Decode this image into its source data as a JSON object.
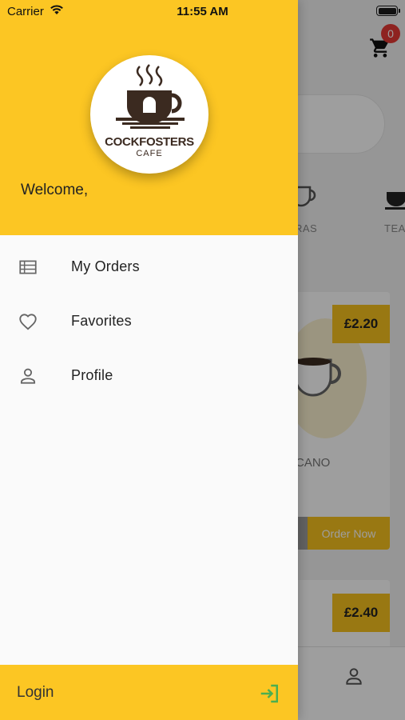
{
  "status_bar": {
    "carrier": "Carrier",
    "time": "11:55 AM"
  },
  "drawer": {
    "logo": {
      "name": "COCKFOSTERS",
      "subtitle": "CAFE"
    },
    "welcome": "Welcome,",
    "menu": [
      {
        "label": "My Orders",
        "icon": "list-icon"
      },
      {
        "label": "Favorites",
        "icon": "heart-icon"
      },
      {
        "label": "Profile",
        "icon": "person-icon"
      }
    ],
    "footer": {
      "login_label": "Login",
      "icon": "login-icon"
    }
  },
  "background_app": {
    "cart_count": "0",
    "categories": [
      "RAS",
      "TEA"
    ],
    "products": [
      {
        "price": "£2.20",
        "name": "RICANO",
        "order_label": "Order Now"
      },
      {
        "price": "£2.40"
      }
    ]
  },
  "colors": {
    "accent": "#fcc623",
    "login_icon": "#4caf50",
    "badge": "#e53935"
  }
}
